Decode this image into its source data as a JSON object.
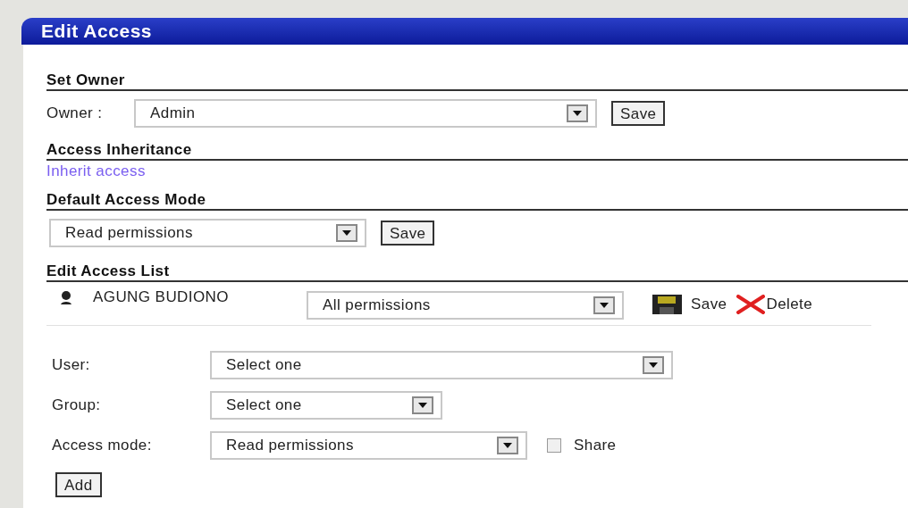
{
  "panel": {
    "title": "Edit Access"
  },
  "set_owner": {
    "heading": "Set Owner",
    "label": "Owner :",
    "select": "Admin",
    "button": "Save"
  },
  "inheritance": {
    "heading": "Access Inheritance",
    "link": "Inherit access"
  },
  "default_mode": {
    "heading": "Default Access Mode",
    "select": "Read permissions",
    "button": "Save"
  },
  "access_list": {
    "heading": "Edit Access List",
    "entries": [
      {
        "name": "AGUNG BUDIONO",
        "select": "All permissions",
        "save": "Save",
        "delete": "Delete"
      }
    ]
  },
  "add_form": {
    "user_label": "User:",
    "user_select": "Select one",
    "group_label": "Group:",
    "group_select": "Select one",
    "mode_label": "Access mode:",
    "mode_select": "Read permissions",
    "share": {
      "label": "Share",
      "checked": false
    },
    "button": "Add"
  }
}
